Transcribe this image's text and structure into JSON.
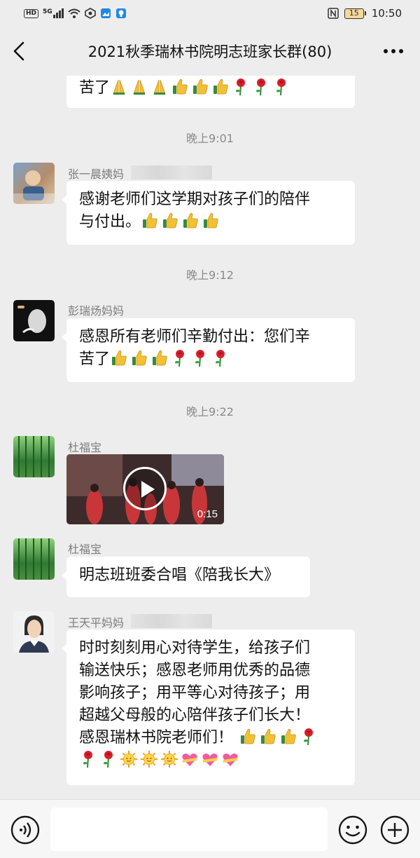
{
  "status_bar": {
    "badge_hd": "HD",
    "signal_label": "5G",
    "battery_level": "15",
    "time": "10:50",
    "icons": [
      "hd-icon",
      "signal-icon",
      "wifi-icon",
      "app-icon",
      "image-icon",
      "lightbulb-icon",
      "nfc-icon",
      "battery-icon"
    ]
  },
  "nav": {
    "title": "2021秋季瑞林书院明志班家长群(80)",
    "icons": [
      "back-icon",
      "more-icon"
    ]
  },
  "messages": [
    {
      "type": "text",
      "sender": "",
      "lines": [
        "苦了"
      ],
      "emoji": [
        "pray",
        "pray",
        "pray",
        "thumb",
        "thumb",
        "thumb",
        "rose",
        "rose",
        "rose"
      ]
    },
    {
      "type": "time",
      "text": "晚上9:01"
    },
    {
      "type": "text",
      "sender": "张一晨姨妈",
      "lines": [
        "感谢老师们这学期对孩子们的陪伴",
        "与付出。"
      ],
      "emoji": [
        "thumb",
        "thumb",
        "thumb",
        "thumb"
      ]
    },
    {
      "type": "time",
      "text": "晚上9:12"
    },
    {
      "type": "text",
      "sender": "彭瑞炀妈妈",
      "lines": [
        "感恩所有老师们辛勤付出：您们辛",
        "苦了"
      ],
      "emoji": [
        "thumb",
        "thumb",
        "thumb",
        "rose",
        "rose",
        "rose"
      ]
    },
    {
      "type": "time",
      "text": "晚上9:22"
    },
    {
      "type": "video",
      "sender": "杜福宝",
      "duration": "0:15"
    },
    {
      "type": "text",
      "sender": "杜福宝",
      "lines": [
        "明志班班委合唱《陪我长大》"
      ]
    },
    {
      "type": "text",
      "sender": "王天平妈妈",
      "lines": [
        "时时刻刻用心对待学生，给孩子们",
        "输送快乐；感恩老师用优秀的品德",
        "影响孩子；用平等心对待孩子；用",
        "超越父母般的心陪伴孩子们长大！",
        "感恩瑞林书院老师们！"
      ],
      "emoji_after_line": [
        "thumb",
        "thumb",
        "thumb",
        "rose"
      ],
      "emoji_line": [
        "rose",
        "rose",
        "sun",
        "sun",
        "sun",
        "heart",
        "heart",
        "heart"
      ]
    }
  ],
  "input_bar": {
    "value": "",
    "icons": [
      "voice-icon",
      "emoji-icon",
      "plus-icon"
    ]
  },
  "colors": {
    "background": "#ededed",
    "bubble": "#ffffff",
    "time_text": "#8a8a8a",
    "sender_text": "#7d7d7d",
    "battery_fill": "#f5d89a"
  }
}
